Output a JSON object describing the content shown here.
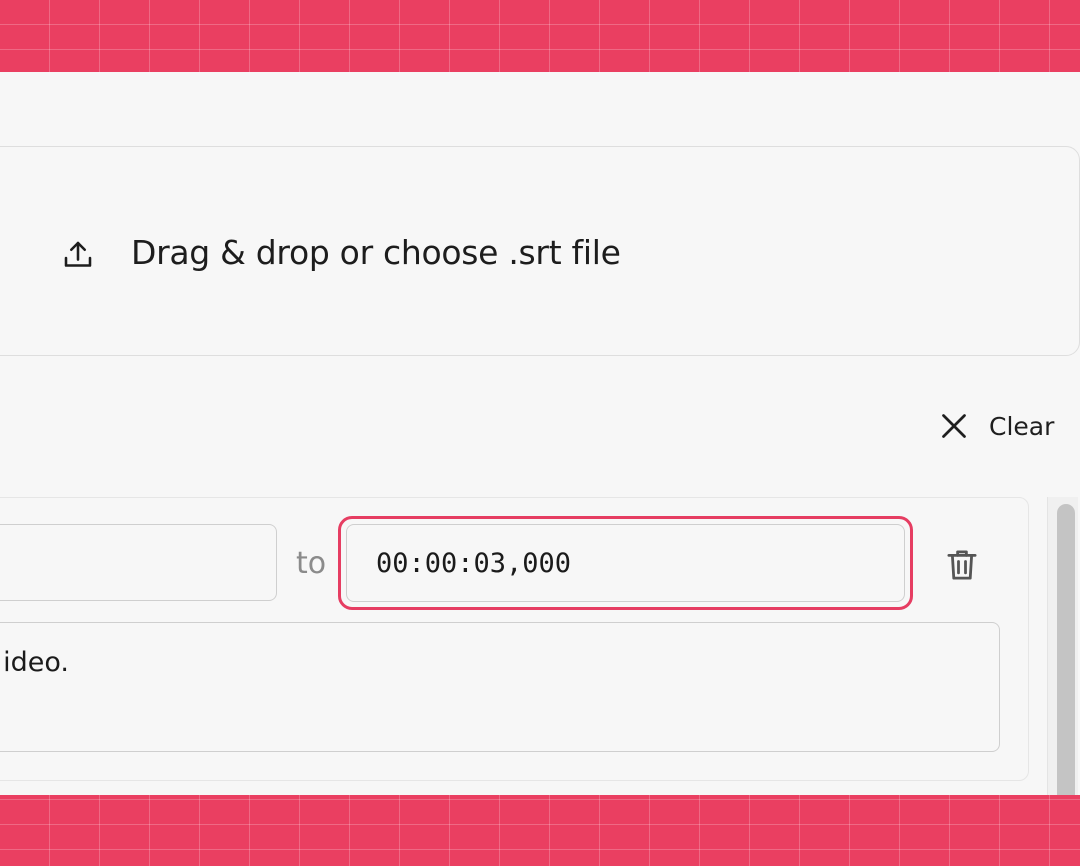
{
  "upload": {
    "label": "Drag & drop or choose .srt file",
    "icon": "upload-icon"
  },
  "actions": {
    "clear_label": "Clear",
    "clear_icon": "close-icon"
  },
  "subtitle_entry": {
    "start_time": "",
    "separator": "to",
    "end_time": "00:00:03,000",
    "text": "ideo.",
    "delete_icon": "trash-icon"
  },
  "colors": {
    "accent": "#e63d62",
    "background_pattern": "#ea3f61",
    "panel": "#f7f7f7"
  }
}
